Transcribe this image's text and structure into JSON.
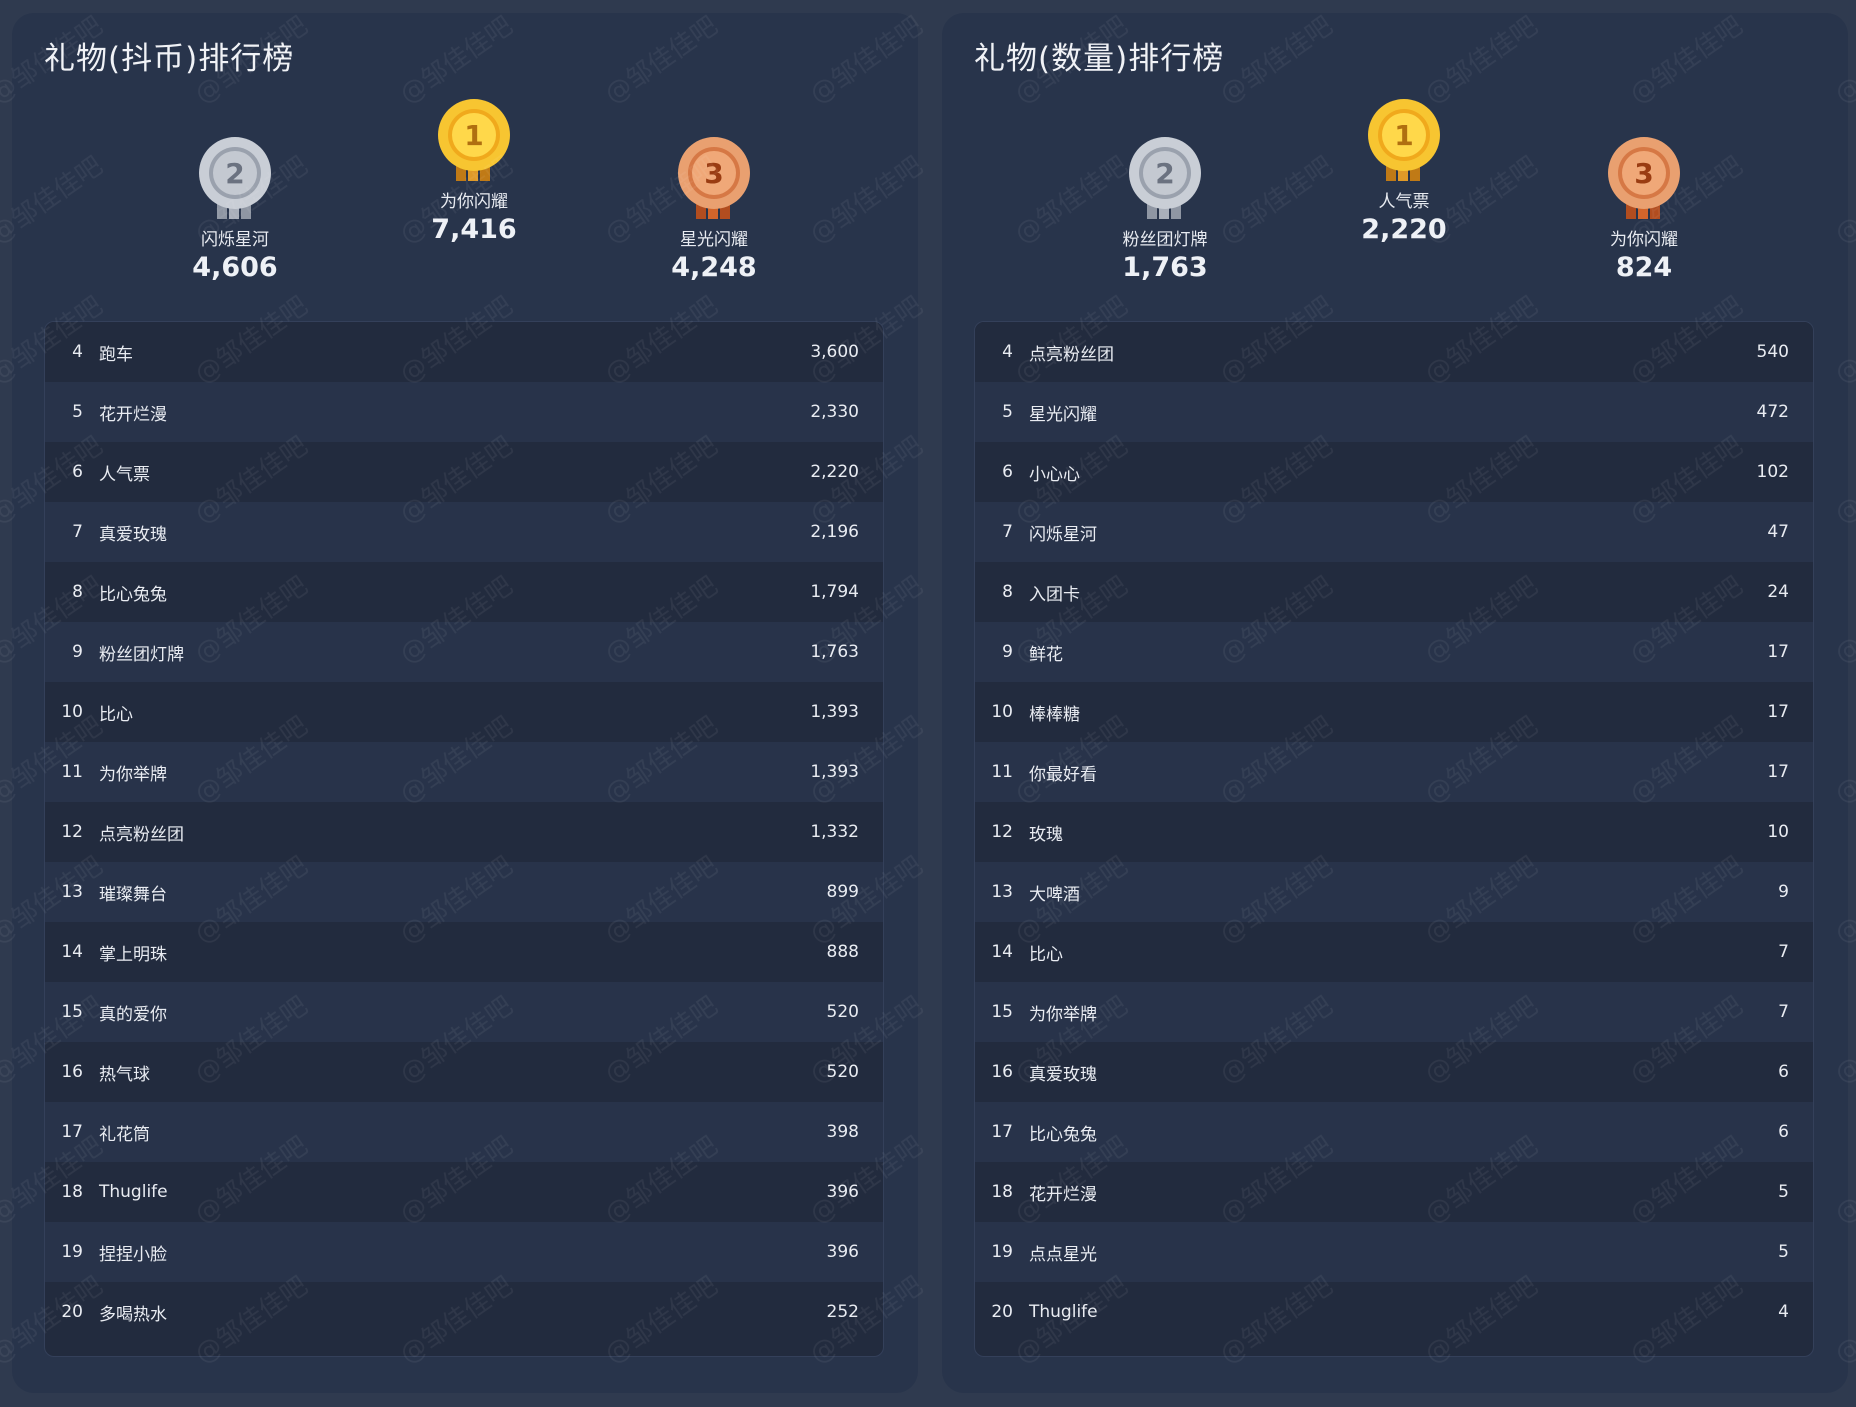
{
  "left": {
    "title": "礼物(抖币)排行榜",
    "podium": [
      {
        "rank": "2",
        "name": "闪烁星河",
        "value": "4,606"
      },
      {
        "rank": "1",
        "name": "为你闪耀",
        "value": "7,416"
      },
      {
        "rank": "3",
        "name": "星光闪耀",
        "value": "4,248"
      }
    ],
    "rows": [
      {
        "rank": "4",
        "name": "跑车",
        "value": "3,600"
      },
      {
        "rank": "5",
        "name": "花开烂漫",
        "value": "2,330"
      },
      {
        "rank": "6",
        "name": "人气票",
        "value": "2,220"
      },
      {
        "rank": "7",
        "name": "真爱玫瑰",
        "value": "2,196"
      },
      {
        "rank": "8",
        "name": "比心兔兔",
        "value": "1,794"
      },
      {
        "rank": "9",
        "name": "粉丝团灯牌",
        "value": "1,763"
      },
      {
        "rank": "10",
        "name": "比心",
        "value": "1,393"
      },
      {
        "rank": "11",
        "name": "为你举牌",
        "value": "1,393"
      },
      {
        "rank": "12",
        "name": "点亮粉丝团",
        "value": "1,332"
      },
      {
        "rank": "13",
        "name": "璀璨舞台",
        "value": "899"
      },
      {
        "rank": "14",
        "name": "掌上明珠",
        "value": "888"
      },
      {
        "rank": "15",
        "name": "真的爱你",
        "value": "520"
      },
      {
        "rank": "16",
        "name": "热气球",
        "value": "520"
      },
      {
        "rank": "17",
        "name": "礼花筒",
        "value": "398"
      },
      {
        "rank": "18",
        "name": "Thuglife",
        "value": "396"
      },
      {
        "rank": "19",
        "name": "捏捏小脸",
        "value": "396"
      },
      {
        "rank": "20",
        "name": "多喝热水",
        "value": "252"
      }
    ]
  },
  "right": {
    "title": "礼物(数量)排行榜",
    "podium": [
      {
        "rank": "2",
        "name": "粉丝团灯牌",
        "value": "1,763"
      },
      {
        "rank": "1",
        "name": "人气票",
        "value": "2,220"
      },
      {
        "rank": "3",
        "name": "为你闪耀",
        "value": "824"
      }
    ],
    "rows": [
      {
        "rank": "4",
        "name": "点亮粉丝团",
        "value": "540"
      },
      {
        "rank": "5",
        "name": "星光闪耀",
        "value": "472"
      },
      {
        "rank": "6",
        "name": "小心心",
        "value": "102"
      },
      {
        "rank": "7",
        "name": "闪烁星河",
        "value": "47"
      },
      {
        "rank": "8",
        "name": "入团卡",
        "value": "24"
      },
      {
        "rank": "9",
        "name": "鲜花",
        "value": "17"
      },
      {
        "rank": "10",
        "name": "棒棒糖",
        "value": "17"
      },
      {
        "rank": "11",
        "name": "你最好看",
        "value": "17"
      },
      {
        "rank": "12",
        "name": "玫瑰",
        "value": "10"
      },
      {
        "rank": "13",
        "name": "大啤酒",
        "value": "9"
      },
      {
        "rank": "14",
        "name": "比心",
        "value": "7"
      },
      {
        "rank": "15",
        "name": "为你举牌",
        "value": "7"
      },
      {
        "rank": "16",
        "name": "真爱玫瑰",
        "value": "6"
      },
      {
        "rank": "17",
        "name": "比心兔兔",
        "value": "6"
      },
      {
        "rank": "18",
        "name": "花开烂漫",
        "value": "5"
      },
      {
        "rank": "19",
        "name": "点点星光",
        "value": "5"
      },
      {
        "rank": "20",
        "name": "Thuglife",
        "value": "4"
      }
    ]
  },
  "watermark": "@邹佳佳吧",
  "colors": {
    "gold": "#f7c531",
    "silver": "#b9bec7",
    "bronze": "#e08c54"
  }
}
